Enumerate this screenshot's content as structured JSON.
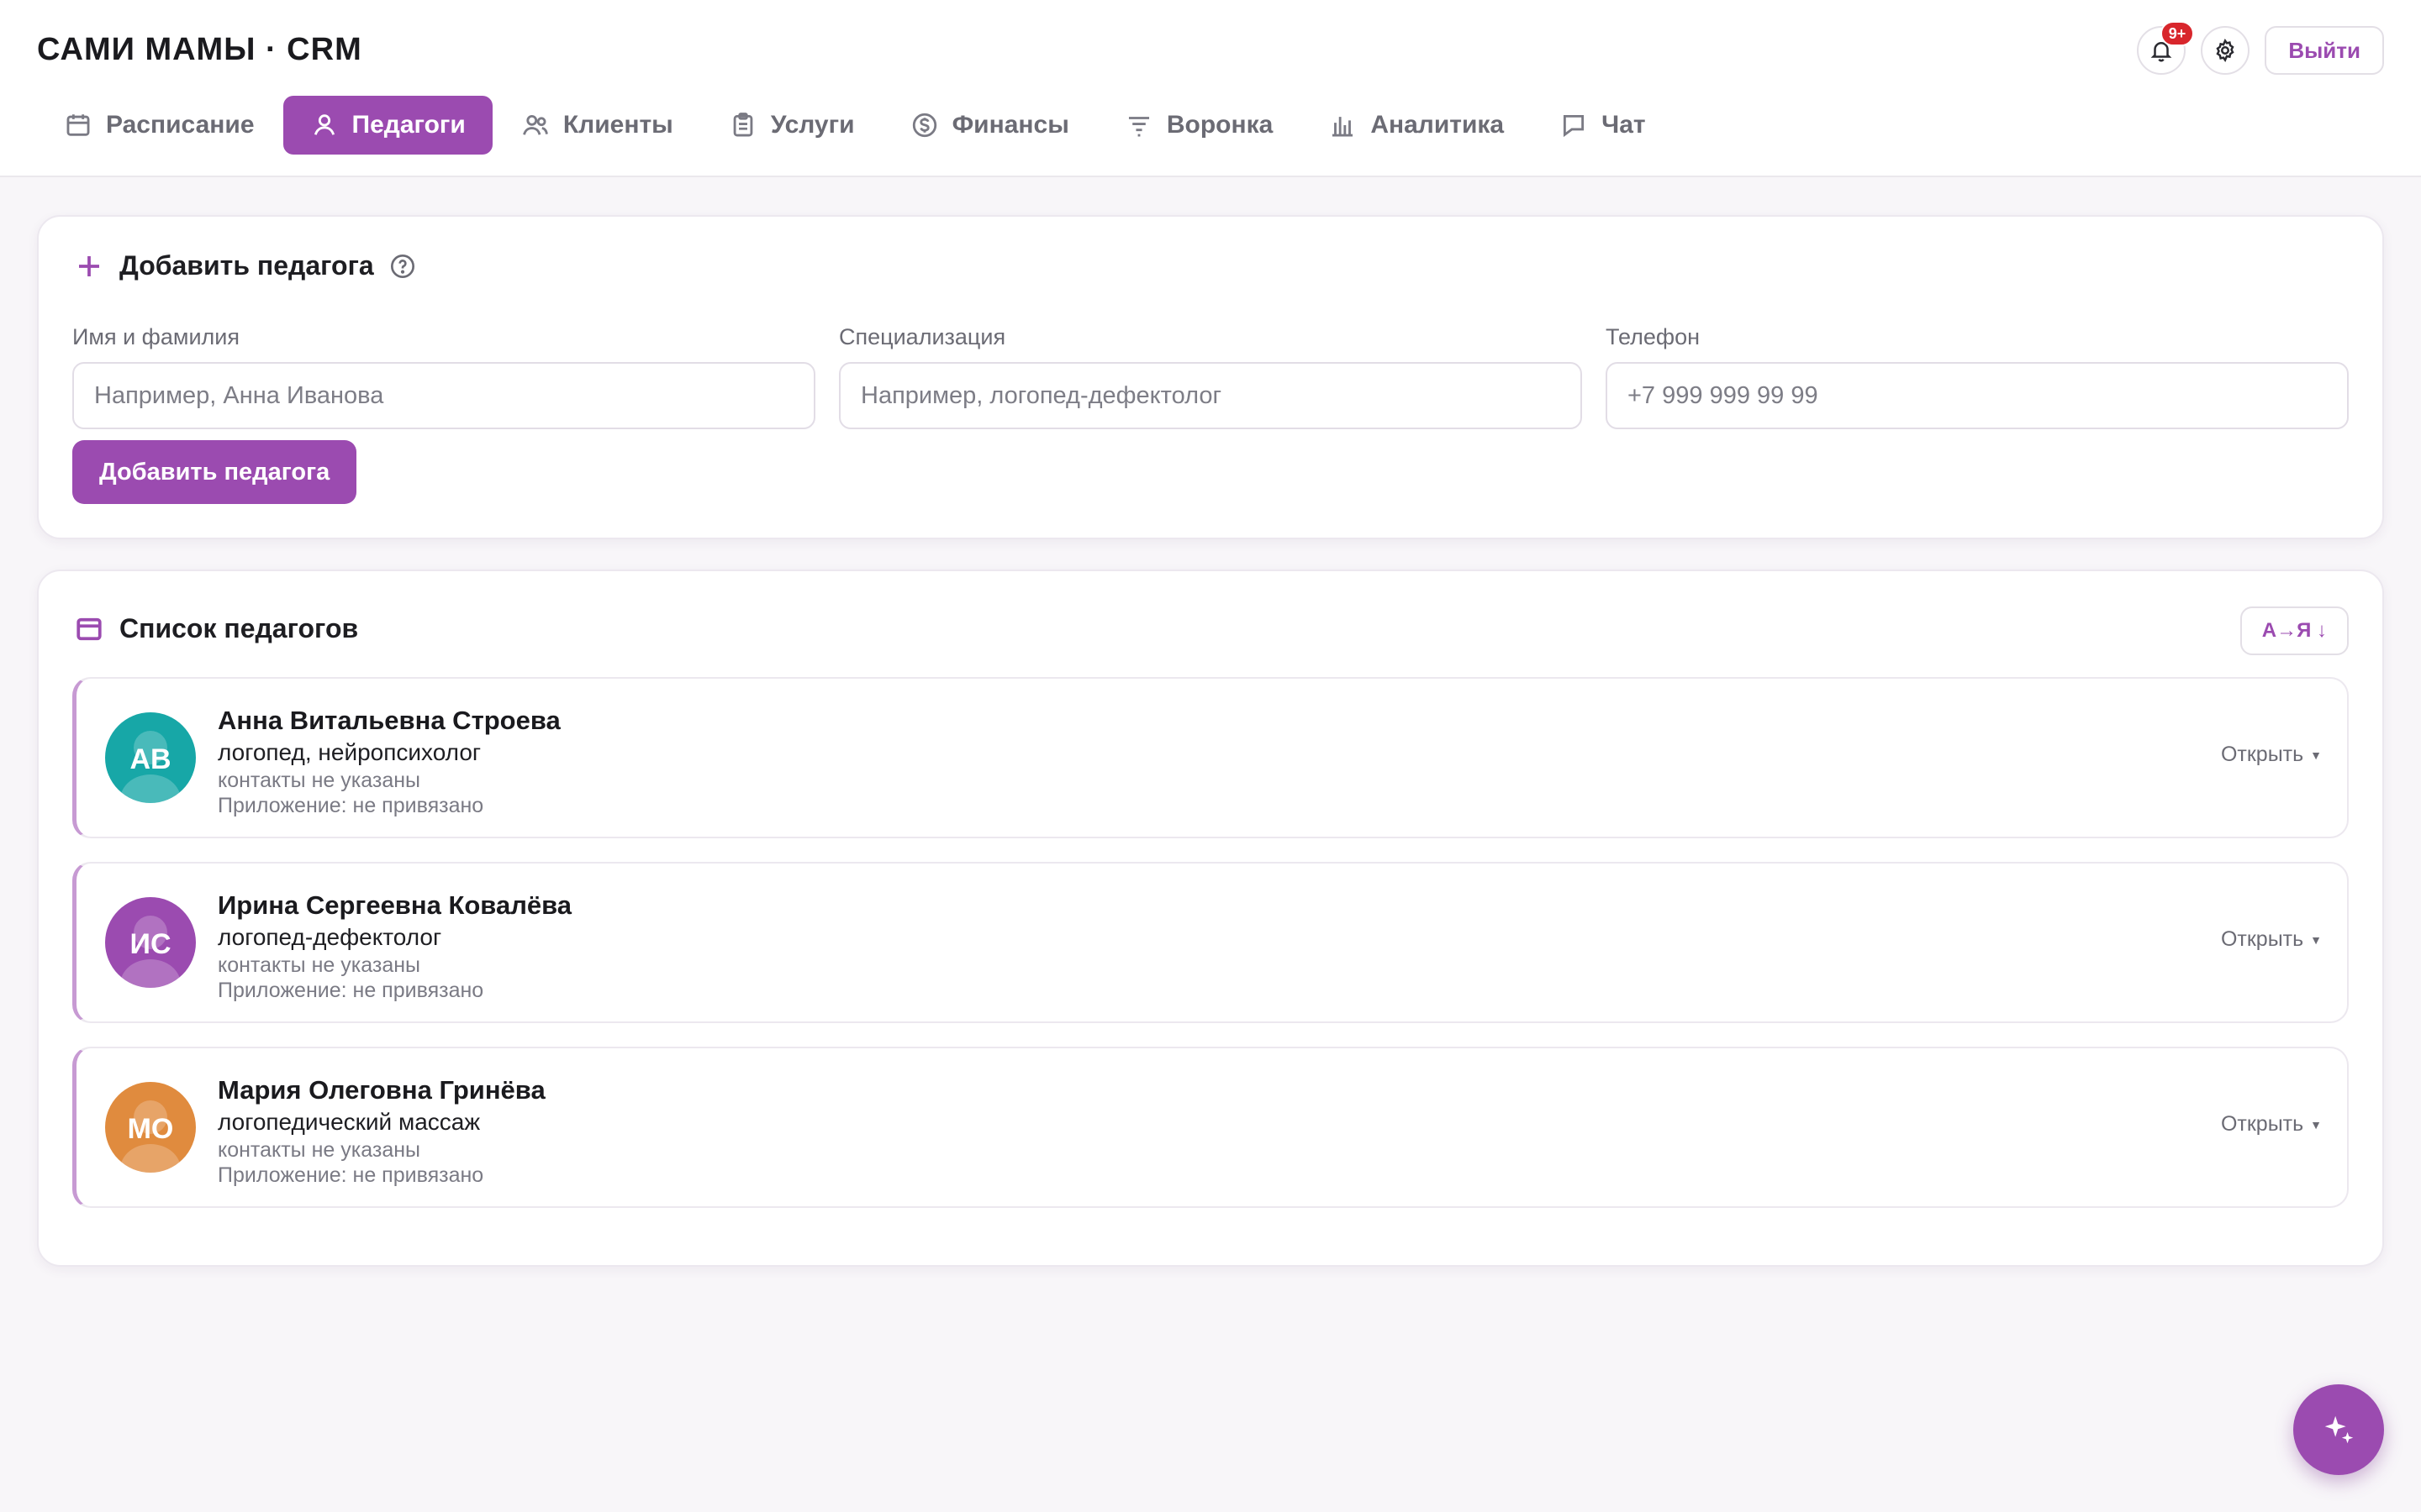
{
  "app": {
    "brand": "САМИ МАМЫ · CRM"
  },
  "nav": {
    "tabs": [
      {
        "label": "Расписание",
        "icon": "calendar-icon",
        "active": false
      },
      {
        "label": "Педагоги",
        "icon": "user-icon",
        "active": true
      },
      {
        "label": "Клиенты",
        "icon": "users-icon",
        "active": false
      },
      {
        "label": "Услуги",
        "icon": "clipboard-icon",
        "active": false
      },
      {
        "label": "Финансы",
        "icon": "dollar-icon",
        "active": false
      },
      {
        "label": "Воронка",
        "icon": "filter-icon",
        "active": false
      },
      {
        "label": "Аналитика",
        "icon": "bar-chart-icon",
        "active": false
      },
      {
        "label": "Чат",
        "icon": "chat-icon",
        "active": false
      }
    ]
  },
  "header": {
    "notifications_badge": "9+",
    "logout_label": "Выйти"
  },
  "add_form": {
    "title": "Добавить педагога",
    "name_label": "Имя и фамилия",
    "name_placeholder": "Например, Анна Иванова",
    "spec_label": "Специализация",
    "spec_placeholder": "Например, логопед-дефектолог",
    "phone_label": "Телефон",
    "phone_placeholder": "+7 999 999 99 99",
    "submit_label": "Добавить педагога"
  },
  "list": {
    "title": "Список педагогов",
    "sort_label": "А→Я ↓",
    "open_label": "Открыть",
    "teachers": [
      {
        "initials": "АВ",
        "name": "Анна Витальевна Строева",
        "specialization": "логопед, нейропсихолог",
        "contacts": "контакты не указаны",
        "app_status": "Приложение: не привязано",
        "color": "#17a7a7"
      },
      {
        "initials": "ИС",
        "name": "Ирина Сергеевна Ковалёва",
        "specialization": "логопед-дефектолог",
        "contacts": "контакты не указаны",
        "app_status": "Приложение: не привязано",
        "color": "#9b4bb0"
      },
      {
        "initials": "МО",
        "name": "Мария Олеговна Гринёва",
        "specialization": "логопедический массаж",
        "contacts": "контакты не указаны",
        "app_status": "Приложение: не привязано",
        "color": "#e08b3e"
      }
    ]
  },
  "colors": {
    "accent": "#9b4bb0",
    "background": "#f8f6f9",
    "badge": "#d8262c"
  }
}
